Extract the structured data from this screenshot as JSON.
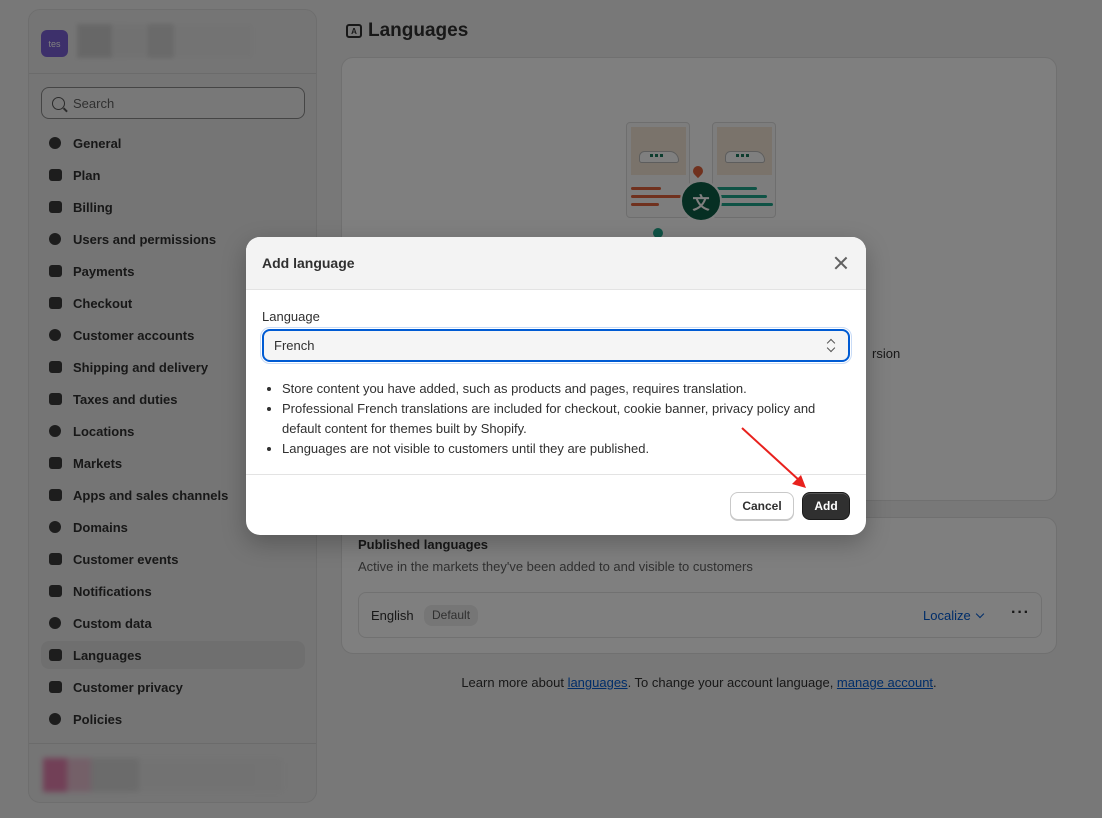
{
  "store": {
    "avatar_text": "tes"
  },
  "search": {
    "placeholder": "Search"
  },
  "sidebar": {
    "items": [
      {
        "label": "General",
        "icon": "store-icon"
      },
      {
        "label": "Plan",
        "icon": "chart-icon"
      },
      {
        "label": "Billing",
        "icon": "dollar-icon"
      },
      {
        "label": "Users and permissions",
        "icon": "users-icon"
      },
      {
        "label": "Payments",
        "icon": "payment-icon"
      },
      {
        "label": "Checkout",
        "icon": "cart-icon"
      },
      {
        "label": "Customer accounts",
        "icon": "person-icon"
      },
      {
        "label": "Shipping and delivery",
        "icon": "truck-icon"
      },
      {
        "label": "Taxes and duties",
        "icon": "tax-icon"
      },
      {
        "label": "Locations",
        "icon": "location-icon"
      },
      {
        "label": "Markets",
        "icon": "globe-icon"
      },
      {
        "label": "Apps and sales channels",
        "icon": "apps-icon"
      },
      {
        "label": "Domains",
        "icon": "domain-icon"
      },
      {
        "label": "Customer events",
        "icon": "cursor-icon"
      },
      {
        "label": "Notifications",
        "icon": "bell-icon"
      },
      {
        "label": "Custom data",
        "icon": "database-icon"
      },
      {
        "label": "Languages",
        "icon": "language-icon",
        "active": true
      },
      {
        "label": "Customer privacy",
        "icon": "lock-icon"
      },
      {
        "label": "Policies",
        "icon": "policy-icon"
      }
    ]
  },
  "page": {
    "title": "Languages",
    "hero_tail": "rsion"
  },
  "published": {
    "title": "Published languages",
    "subtitle": "Active in the markets they've been added to and visible to customers",
    "row": {
      "name": "English",
      "badge": "Default",
      "action": "Localize"
    }
  },
  "footer": {
    "prefix": "Learn more about ",
    "link1": "languages",
    "middle": ". To change your account language, ",
    "link2": "manage account",
    "suffix": "."
  },
  "modal": {
    "title": "Add language",
    "field_label": "Language",
    "selected": "French",
    "bullets": [
      "Store content you have added, such as products and pages, requires translation.",
      "Professional French translations are included for checkout, cookie banner, privacy policy and default content for themes built by Shopify.",
      "Languages are not visible to customers until they are published."
    ],
    "cancel": "Cancel",
    "add": "Add"
  },
  "colors": {
    "accent": "#005bd3",
    "primary_button": "#303030",
    "arrow": "#e8211d"
  }
}
